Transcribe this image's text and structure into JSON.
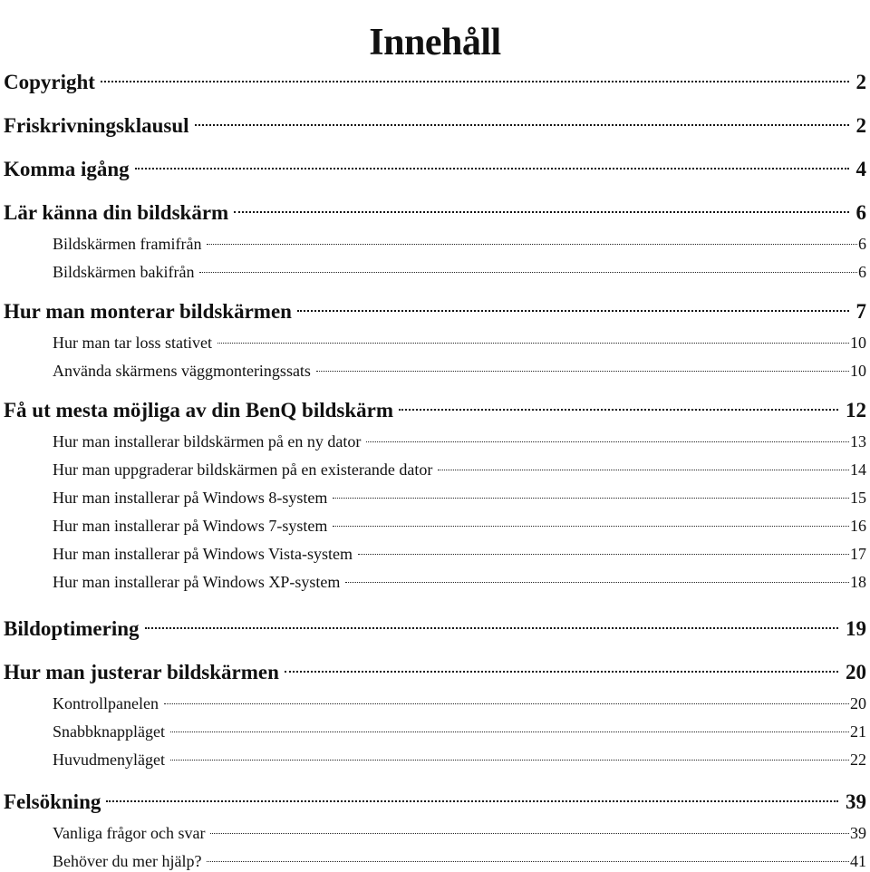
{
  "document": {
    "title": "Innehåll",
    "toc": [
      {
        "level": 1,
        "label": "Copyright",
        "page": "2"
      },
      {
        "level": 1,
        "label": "Friskrivningsklausul",
        "page": "2"
      },
      {
        "level": 1,
        "label": "Komma igång",
        "page": "4"
      },
      {
        "level": 1,
        "label": "Lär känna din bildskärm",
        "page": "6"
      },
      {
        "level": 2,
        "label": "Bildskärmen framifrån",
        "page": "6"
      },
      {
        "level": 2,
        "label": "Bildskärmen bakifrån",
        "page": "6"
      },
      {
        "level": 1,
        "label": "Hur man monterar bildskärmen",
        "page": "7"
      },
      {
        "level": 2,
        "label": "Hur man tar loss stativet",
        "page": "10"
      },
      {
        "level": 2,
        "label": "Använda skärmens väggmonteringssats",
        "page": "10"
      },
      {
        "level": 1,
        "label": "Få ut mesta möjliga av din BenQ bildskärm",
        "page": "12"
      },
      {
        "level": 2,
        "label": "Hur man installerar bildskärmen på en ny dator",
        "page": "13"
      },
      {
        "level": 2,
        "label": "Hur man uppgraderar bildskärmen på en existerande dator",
        "page": "14"
      },
      {
        "level": 2,
        "label": "Hur man installerar på Windows 8-system",
        "page": "15"
      },
      {
        "level": 2,
        "label": "Hur man installerar på Windows 7-system",
        "page": "16"
      },
      {
        "level": 2,
        "label": "Hur man installerar på Windows Vista-system",
        "page": "17"
      },
      {
        "level": 2,
        "label": "Hur man installerar på Windows XP-system",
        "page": "18"
      },
      {
        "level": 1,
        "label": "Bildoptimering",
        "page": "19"
      },
      {
        "level": 1,
        "label": "Hur man justerar bildskärmen",
        "page": "20"
      },
      {
        "level": 2,
        "label": "Kontrollpanelen",
        "page": "20"
      },
      {
        "level": 2,
        "label": "Snabbknappläget",
        "page": "21"
      },
      {
        "level": 2,
        "label": "Huvudmenyläget",
        "page": "22"
      },
      {
        "level": 1,
        "label": "Felsökning",
        "page": "39"
      },
      {
        "level": 2,
        "label": "Vanliga frågor och svar",
        "page": "39"
      },
      {
        "level": 2,
        "label": "Behöver du mer hjälp?",
        "page": "41"
      }
    ]
  }
}
